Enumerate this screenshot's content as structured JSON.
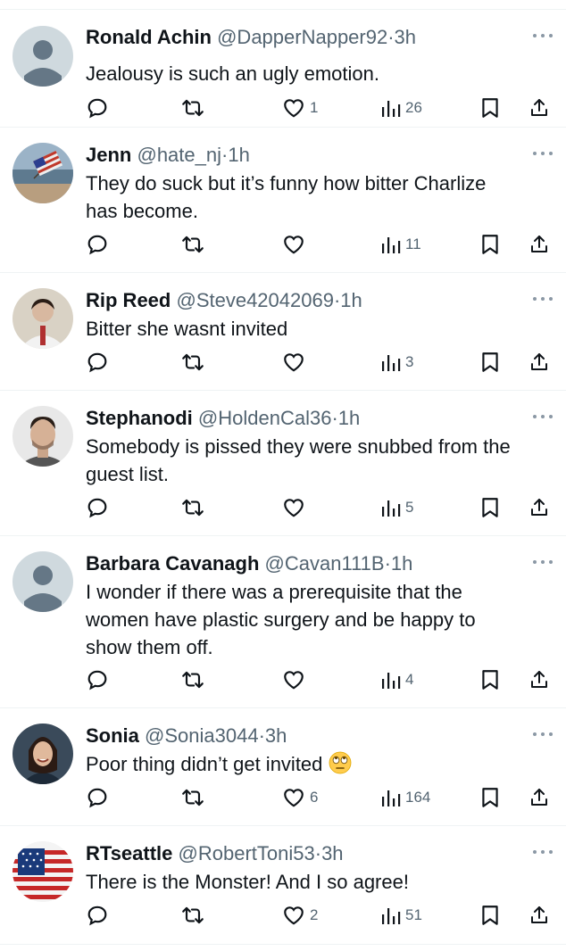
{
  "colors": {
    "text": "#0f1419",
    "muted": "#536471",
    "divider": "#eff3f4"
  },
  "icons": {
    "reply": "reply-icon",
    "repost": "repost-icon",
    "like": "heart-icon",
    "views": "views-icon",
    "bookmark": "bookmark-icon",
    "share": "share-icon",
    "more": "more-icon"
  },
  "tweets": [
    {
      "name": "Ronald Achin",
      "handle": "@DapperNapper92",
      "dot": "·",
      "time": "3h",
      "text_lines": [
        "Jealousy is such an ugly emotion."
      ],
      "likes": "1",
      "views": "26",
      "avatar": "default"
    },
    {
      "name": "Jenn",
      "handle": "@hate_nj",
      "dot": "·",
      "time": "1h",
      "text_lines": [
        "They do suck but it’s funny how bitter Charlize",
        "has become."
      ],
      "likes": "",
      "views": "11",
      "avatar": "flag-beach"
    },
    {
      "name": "Rip Reed",
      "handle": "@Steve42042069",
      "dot": "·",
      "time": "1h",
      "text_lines": [
        "Bitter she wasnt invited"
      ],
      "likes": "",
      "views": "3",
      "avatar": "man-shirt"
    },
    {
      "name": "Stephanodi",
      "handle": "@HoldenCal36",
      "dot": "·",
      "time": "1h",
      "text_lines": [
        "Somebody is pissed they were snubbed from the",
        "guest list."
      ],
      "likes": "",
      "views": "5",
      "avatar": "man-face"
    },
    {
      "name": "Barbara Cavanagh",
      "handle": "@Cavan111B",
      "dot": "·",
      "time": "1h",
      "text_lines": [
        "I wonder if there was a prerequisite that the",
        "women have plastic surgery and be happy to",
        "show them off."
      ],
      "likes": "",
      "views": "4",
      "avatar": "default"
    },
    {
      "name": "Sonia",
      "handle": "@Sonia3044",
      "dot": "·",
      "time": "3h",
      "text_lines": [
        "Poor thing didn’t get invited"
      ],
      "emoji": "face-with-rolling-eyes",
      "likes": "6",
      "views": "164",
      "avatar": "woman-smile"
    },
    {
      "name": "RTseattle",
      "handle": "@RobertToni53",
      "dot": "·",
      "time": "3h",
      "text_lines": [
        "There is the Monster!  And I so agree!"
      ],
      "likes": "2",
      "views": "51",
      "avatar": "us-flag"
    }
  ]
}
